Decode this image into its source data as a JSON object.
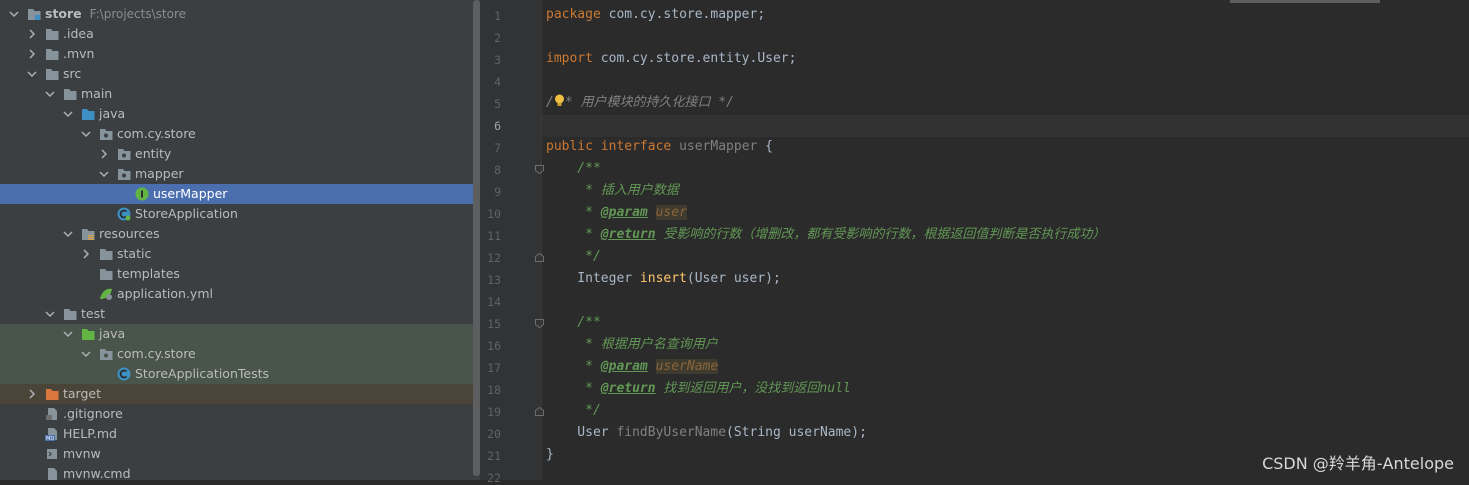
{
  "project_tree": {
    "root": {
      "name": "store",
      "path": "F:\\projects\\store"
    },
    "items": [
      {
        "label": "store",
        "hint": "F:\\projects\\store"
      },
      {
        "label": ".idea"
      },
      {
        "label": ".mvn"
      },
      {
        "label": "src"
      },
      {
        "label": "main"
      },
      {
        "label": "java"
      },
      {
        "label": "com.cy.store"
      },
      {
        "label": "entity"
      },
      {
        "label": "mapper"
      },
      {
        "label": "userMapper"
      },
      {
        "label": "StoreApplication"
      },
      {
        "label": "resources"
      },
      {
        "label": "static"
      },
      {
        "label": "templates"
      },
      {
        "label": "application.yml"
      },
      {
        "label": "test"
      },
      {
        "label": "java"
      },
      {
        "label": "com.cy.store"
      },
      {
        "label": "StoreApplicationTests"
      },
      {
        "label": "target"
      },
      {
        "label": ".gitignore"
      },
      {
        "label": "HELP.md"
      },
      {
        "label": "mvnw"
      },
      {
        "label": "mvnw.cmd"
      }
    ],
    "selected": "userMapper"
  },
  "editor": {
    "line_numbers": [
      "1",
      "2",
      "3",
      "4",
      "5",
      "6",
      "7",
      "8",
      "9",
      "10",
      "11",
      "12",
      "13",
      "14",
      "15",
      "16",
      "17",
      "18",
      "19",
      "20",
      "21",
      "22"
    ],
    "lines": {
      "l1_kw": "package",
      "l1_rest": " com.cy.store.mapper;",
      "l3_kw": "import",
      "l3_rest": " com.cy.store.entity.User;",
      "l5_a": "/",
      "l5_b": "* 用户模块的持久化接口 */",
      "l7_kw1": "public",
      "l7_kw2": "interface",
      "l7_name": "userMapper",
      "l7_brace": " {",
      "l8": "    /**",
      "l9": "     * 插入用户数据",
      "l10_a": "     * ",
      "l10_tag": "@param",
      "l10_p": "user",
      "l11_a": "     * ",
      "l11_tag": "@return",
      "l11_text": " 受影响的行数（增删改，都有受影响的行数，根据返回值判断是否执行成功）",
      "l12": "     */",
      "l13_a": "    Integer ",
      "l13_m": "insert",
      "l13_b": "(User user);",
      "l15": "    /**",
      "l16": "     * 根据用户名查询用户",
      "l17_a": "     * ",
      "l17_tag": "@param",
      "l17_p": "userName",
      "l18_a": "     * ",
      "l18_tag": "@return",
      "l18_text": " 找到返回用户，没找到返回null",
      "l19": "     */",
      "l20_a": "    User ",
      "l20_m": "findByUserName",
      "l20_b": "(String userName);",
      "l21": "}"
    }
  },
  "watermark": "CSDN @羚羊角-Antelope",
  "colors": {
    "sidebar_bg": "#3c3f41",
    "editor_bg": "#2b2b2b",
    "selection": "#4b6eaf",
    "keyword": "#cc7832",
    "comment": "#629755"
  }
}
